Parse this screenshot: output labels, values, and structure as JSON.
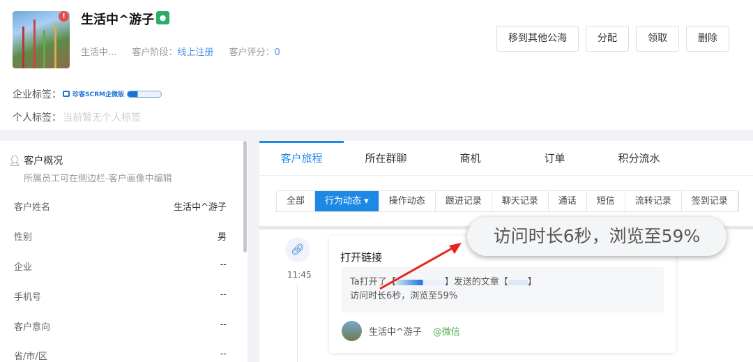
{
  "customer": {
    "name": "生活中^游子",
    "short_name": "生活中...",
    "stage_label": "客户阶段：",
    "stage": "线上注册",
    "score_label": "客户评分：",
    "score": "0",
    "alert": "!",
    "wechat_icon": "wechat-icon"
  },
  "actions": [
    "移到其他公海",
    "分配",
    "领取",
    "删除"
  ],
  "tags": {
    "enterprise_label": "企业标签：",
    "enterprise_tag": "珍客SCRM企微版",
    "personal_label": "个人标签：",
    "personal_empty": "当前暂无个人标签"
  },
  "overview": {
    "title": "客户概况",
    "subtitle": "所属员工可在侧边栏-客户画像中编辑",
    "fields": [
      {
        "label": "客户姓名",
        "value": "生活中^游子"
      },
      {
        "label": "性别",
        "value": "男"
      },
      {
        "label": "企业",
        "value": "--"
      },
      {
        "label": "手机号",
        "value": "--"
      },
      {
        "label": "客户意向",
        "value": "--"
      },
      {
        "label": "省/市/区",
        "value": "--"
      }
    ]
  },
  "tabs": [
    "客户旅程",
    "所在群聊",
    "商机",
    "订单",
    "积分流水"
  ],
  "filters": [
    "全部",
    "行为动态 ▾",
    "操作动态",
    "跟进记录",
    "聊天记录",
    "通话",
    "短信",
    "流转记录",
    "签到记录"
  ],
  "timeline": {
    "time": "11:45",
    "title": "打开链接",
    "line1_a": "Ta打开了【",
    "line1_b": "】发送的文章【",
    "line1_c": "】",
    "line2": "访问时长6秒，浏览至59%",
    "user": "生活中^游子",
    "via": "@微信"
  },
  "callout": "访问时长6秒，浏览至59%",
  "colors": {
    "accent": "#1e88e5",
    "arrow": "#e8231f"
  }
}
